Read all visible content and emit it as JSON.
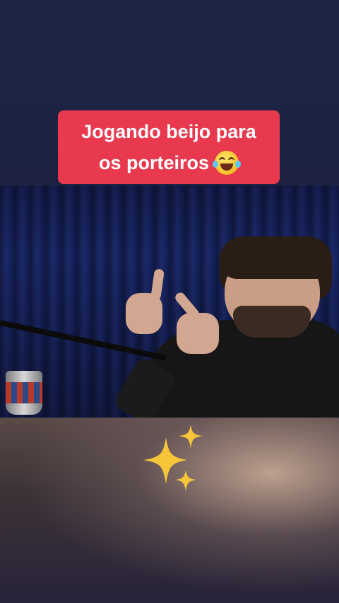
{
  "caption": {
    "line1": "Jogando beijo para",
    "line2": "os porteiros",
    "emoji": "face-with-tears-of-joy-icon"
  },
  "decor": {
    "sparkles_icon": "sparkles-icon"
  },
  "colors": {
    "caption_bg": "#e8394f",
    "caption_text": "#ffffff",
    "background": "#1c2340",
    "sparkle": "#f7c53a"
  }
}
